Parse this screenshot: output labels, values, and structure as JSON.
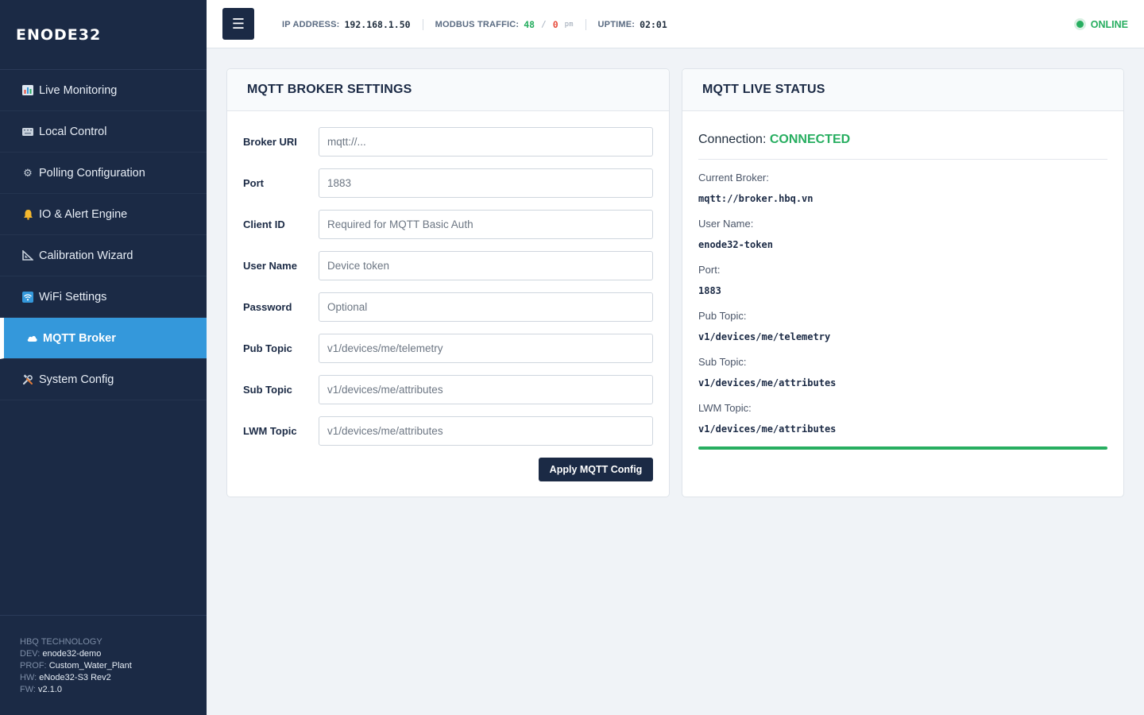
{
  "app": {
    "brand": "ENODE32"
  },
  "sidebar": {
    "items": [
      {
        "label": "Live Monitoring",
        "icon": "bar-chart-icon"
      },
      {
        "label": "Local Control",
        "icon": "keyboard-icon"
      },
      {
        "label": "Polling Configuration",
        "icon": "gear-icon"
      },
      {
        "label": "IO & Alert Engine",
        "icon": "bell-icon"
      },
      {
        "label": "Calibration Wizard",
        "icon": "triangle-ruler-icon"
      },
      {
        "label": "WiFi Settings",
        "icon": "wifi-icon"
      },
      {
        "label": "MQTT Broker",
        "icon": "cloud-icon",
        "active": true
      },
      {
        "label": "System Config",
        "icon": "tools-icon"
      }
    ],
    "footer": {
      "company": "HBQ TECHNOLOGY",
      "dev_label": "DEV:",
      "dev": "enode32-demo",
      "prof_label": "PROF:",
      "prof": "Custom_Water_Plant",
      "hw_label": "HW:",
      "hw": "eNode32-S3 Rev2",
      "fw_label": "FW:",
      "fw": "v2.1.0"
    }
  },
  "header": {
    "menu_icon": "☰",
    "ip_label": "IP ADDRESS:",
    "ip": "192.168.1.50",
    "traffic_label": "MODBUS TRAFFIC:",
    "traffic_ok": "48",
    "traffic_sep": "/",
    "traffic_err": "0",
    "traffic_unit": "pm",
    "uptime_label": "UPTIME:",
    "uptime": "02:01",
    "status": "ONLINE"
  },
  "broker_settings": {
    "title": "MQTT BROKER SETTINGS",
    "fields": [
      {
        "label": "Broker URI",
        "value": "",
        "placeholder": "mqtt://..."
      },
      {
        "label": "Port",
        "value": "",
        "placeholder": "1883"
      },
      {
        "label": "Client ID",
        "value": "",
        "placeholder": "Required for MQTT Basic Auth"
      },
      {
        "label": "User Name",
        "value": "",
        "placeholder": "Device token"
      },
      {
        "label": "Password",
        "value": "",
        "placeholder": "Optional"
      },
      {
        "label": "Pub Topic",
        "value": "",
        "placeholder": "v1/devices/me/telemetry"
      },
      {
        "label": "Sub Topic",
        "value": "",
        "placeholder": "v1/devices/me/attributes"
      },
      {
        "label": "LWM Topic",
        "value": "",
        "placeholder": "v1/devices/me/attributes"
      }
    ],
    "apply_label": "Apply MQTT Config"
  },
  "live_status": {
    "title": "MQTT LIVE STATUS",
    "connection_label": "Connection:",
    "connection_value": "CONNECTED",
    "items": [
      {
        "key": "Current Broker:",
        "value": "mqtt://broker.hbq.vn"
      },
      {
        "key": "User Name:",
        "value": "enode32-token"
      },
      {
        "key": "Port:",
        "value": "1883"
      },
      {
        "key": "Pub Topic:",
        "value": "v1/devices/me/telemetry"
      },
      {
        "key": "Sub Topic:",
        "value": "v1/devices/me/attributes"
      },
      {
        "key": "LWM Topic:",
        "value": "v1/devices/me/attributes"
      }
    ],
    "progress_percent": 100
  },
  "colors": {
    "sidebar": "#1b2a45",
    "accent": "#3498db",
    "success": "#27ae60",
    "error": "#e74c3c"
  }
}
